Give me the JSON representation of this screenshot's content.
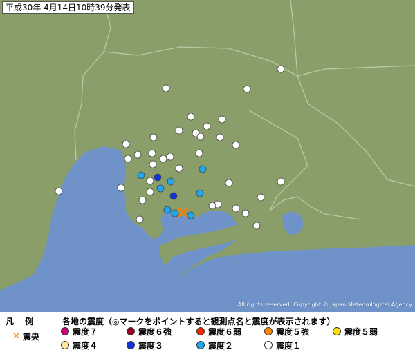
{
  "header": {
    "title": "平成30年 4月14日10時39分発表"
  },
  "map": {
    "copyright": "All rights reserved. Copyright © Japan Meteorological Agency",
    "colors": {
      "land": "#8a9e6a",
      "sea": "#6f93c8",
      "border": "#bdc8a4",
      "coast": "#ffffff"
    }
  },
  "legend": {
    "title": "凡 例",
    "description": "各地の震度（◎マークをポイントすると観測点名と震度が表示されます）",
    "epicenter_label": "震央",
    "items": [
      {
        "label": "震度７",
        "color": "#cc0077"
      },
      {
        "label": "震度６強",
        "color": "#990022"
      },
      {
        "label": "震度６弱",
        "color": "#ff2200"
      },
      {
        "label": "震度５強",
        "color": "#ff8800"
      },
      {
        "label": "震度５弱",
        "color": "#ffdd00"
      },
      {
        "label": "震度４",
        "color": "#ffe699"
      },
      {
        "label": "震度３",
        "color": "#1133dd"
      },
      {
        "label": "震度２",
        "color": "#22a6ee"
      },
      {
        "label": "震度１",
        "color": "#ffffff"
      }
    ]
  }
}
